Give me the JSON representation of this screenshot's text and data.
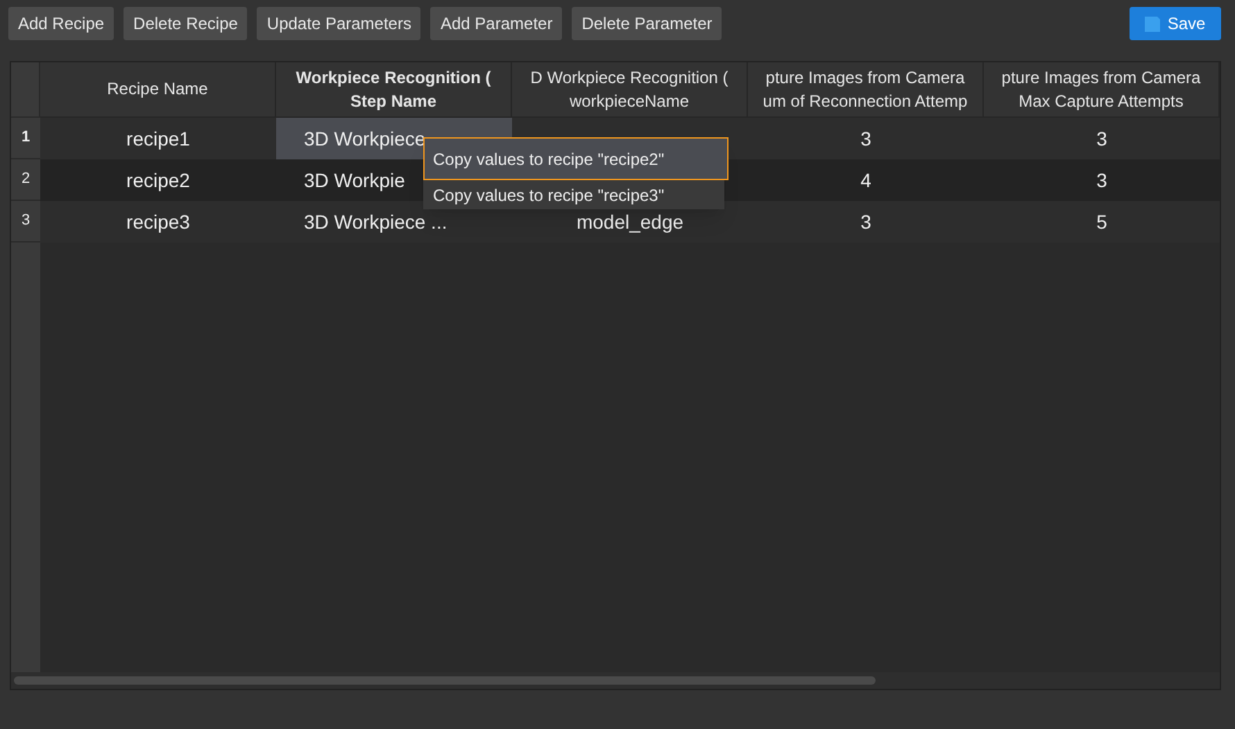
{
  "toolbar": {
    "buttons": [
      "Add Recipe",
      "Delete Recipe",
      "Update Parameters",
      "Add Parameter",
      "Delete Parameter"
    ],
    "save": "Save"
  },
  "table": {
    "columns": [
      {
        "lines": [
          "Recipe Name"
        ],
        "selected": false
      },
      {
        "lines": [
          "Workpiece Recognition (",
          "Step Name"
        ],
        "selected": true
      },
      {
        "lines": [
          "D Workpiece Recognition (",
          "workpieceName"
        ],
        "selected": false
      },
      {
        "lines": [
          "pture Images from Camera",
          "um of Reconnection Attemp"
        ],
        "selected": false
      },
      {
        "lines": [
          "pture Images from Camera",
          "Max Capture Attempts"
        ],
        "selected": false
      }
    ],
    "rows": [
      {
        "number": "1",
        "selected": true,
        "cells": [
          {
            "text": "recipe1",
            "selected": false
          },
          {
            "text": "3D Workpiece",
            "selected": true
          },
          {
            "text": "",
            "selected": false
          },
          {
            "text": "3",
            "selected": false
          },
          {
            "text": "3",
            "selected": false
          }
        ]
      },
      {
        "number": "2",
        "selected": false,
        "cells": [
          {
            "text": "recipe2",
            "selected": false
          },
          {
            "text": "3D Workpie",
            "selected": false
          },
          {
            "text": "",
            "selected": false
          },
          {
            "text": "4",
            "selected": false
          },
          {
            "text": "3",
            "selected": false
          }
        ]
      },
      {
        "number": "3",
        "selected": false,
        "cells": [
          {
            "text": "recipe3",
            "selected": false
          },
          {
            "text": "3D Workpiece ...",
            "selected": false
          },
          {
            "text": "model_edge",
            "selected": false
          },
          {
            "text": "3",
            "selected": false
          },
          {
            "text": "5",
            "selected": false
          }
        ]
      }
    ]
  },
  "context_menu": {
    "items": [
      {
        "label": "Copy values to recipe \"recipe2\"",
        "selected": true
      },
      {
        "label": "Copy values to recipe \"recipe3\"",
        "selected": false
      }
    ]
  }
}
